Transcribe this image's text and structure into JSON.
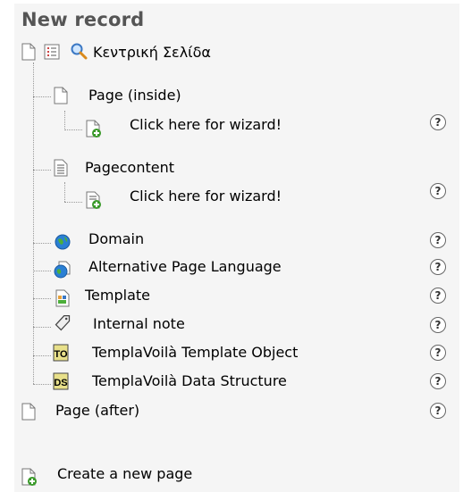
{
  "header": {
    "title": "New record"
  },
  "top": {
    "site_label": "Κεντρική Σελίδα"
  },
  "tree": {
    "page_inside": {
      "label": "Page (inside)",
      "wizard": "Click here for wizard!"
    },
    "pagecontent": {
      "label": "Pagecontent",
      "wizard": "Click here for wizard!"
    },
    "items": [
      {
        "label": "Domain"
      },
      {
        "label": "Alternative Page Language"
      },
      {
        "label": "Template"
      },
      {
        "label": "Internal note"
      },
      {
        "label": "TemplaVoilà Template Object"
      },
      {
        "label": "TemplaVoilà Data Structure"
      }
    ],
    "page_after": {
      "label": "Page (after)"
    }
  },
  "bottom": {
    "create_page": "Create a new page"
  },
  "help_glyph": "?",
  "colors": {
    "globe": "#2a7fd4",
    "template_badge": "#e8e08a",
    "panel": "#f5f5f5"
  }
}
